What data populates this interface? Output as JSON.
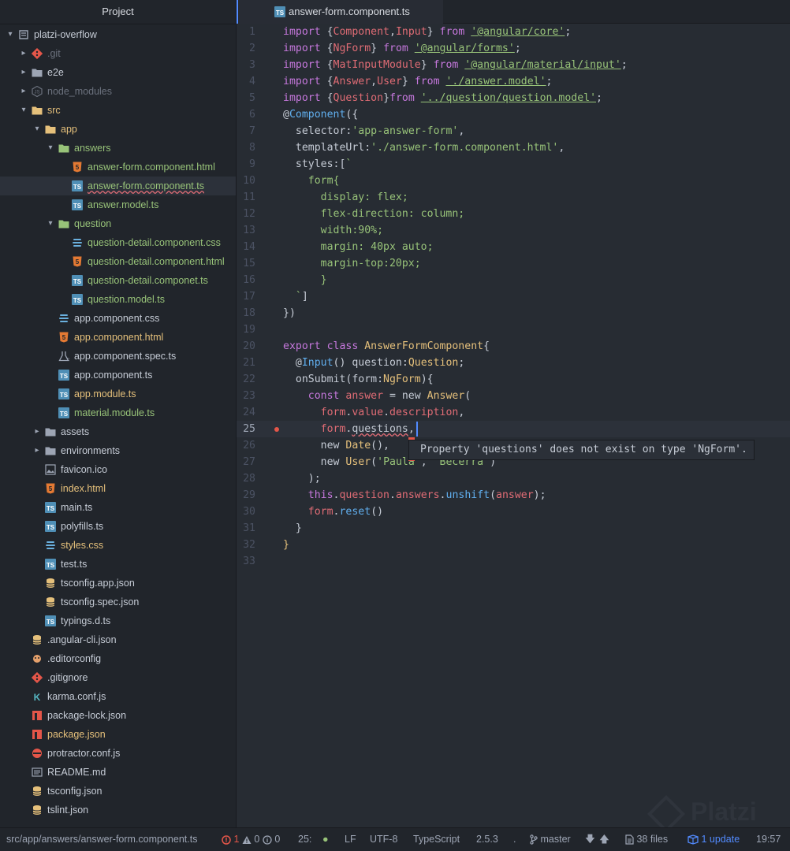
{
  "sidebar": {
    "title": "Project",
    "tree": [
      {
        "label": "platzi-overflow",
        "depth": 0,
        "type": "folder",
        "expanded": true,
        "color": "#c6ccd6",
        "icon": "repo-icon"
      },
      {
        "label": ".git",
        "depth": 1,
        "type": "folder",
        "expanded": false,
        "color": "#6b717d",
        "icon": "git-icon"
      },
      {
        "label": "e2e",
        "depth": 1,
        "type": "folder",
        "expanded": false,
        "color": "#c6ccd6",
        "icon": "folder-icon"
      },
      {
        "label": "node_modules",
        "depth": 1,
        "type": "folder",
        "expanded": false,
        "color": "#6b717d",
        "icon": "nodejs-icon"
      },
      {
        "label": "src",
        "depth": 1,
        "type": "folder",
        "expanded": true,
        "color": "#e5c07b",
        "icon": "folder-icon"
      },
      {
        "label": "app",
        "depth": 2,
        "type": "folder",
        "expanded": true,
        "color": "#e5c07b",
        "icon": "folder-icon"
      },
      {
        "label": "answers",
        "depth": 3,
        "type": "folder",
        "expanded": true,
        "color": "#98c379",
        "icon": "folder-icon"
      },
      {
        "label": "answer-form.component.html",
        "depth": 4,
        "type": "file",
        "color": "#98c379",
        "icon": "html5-icon"
      },
      {
        "label": "answer-form.component.ts",
        "depth": 4,
        "type": "file",
        "color": "#98c379",
        "icon": "typescript-icon",
        "selected": true,
        "error": true
      },
      {
        "label": "answer.model.ts",
        "depth": 4,
        "type": "file",
        "color": "#98c379",
        "icon": "typescript-icon"
      },
      {
        "label": "question",
        "depth": 3,
        "type": "folder",
        "expanded": true,
        "color": "#98c379",
        "icon": "folder-icon"
      },
      {
        "label": "question-detail.component.css",
        "depth": 4,
        "type": "file",
        "color": "#98c379",
        "icon": "css3-icon"
      },
      {
        "label": "question-detail.component.html",
        "depth": 4,
        "type": "file",
        "color": "#98c379",
        "icon": "html5-icon"
      },
      {
        "label": "question-detail.componet.ts",
        "depth": 4,
        "type": "file",
        "color": "#98c379",
        "icon": "typescript-icon"
      },
      {
        "label": "question.model.ts",
        "depth": 4,
        "type": "file",
        "color": "#98c379",
        "icon": "typescript-icon"
      },
      {
        "label": "app.component.css",
        "depth": 3,
        "type": "file",
        "color": "#c6ccd6",
        "icon": "css3-icon"
      },
      {
        "label": "app.component.html",
        "depth": 3,
        "type": "file",
        "color": "#e5c07b",
        "icon": "html5-icon"
      },
      {
        "label": "app.component.spec.ts",
        "depth": 3,
        "type": "file",
        "color": "#c6ccd6",
        "icon": "test-icon"
      },
      {
        "label": "app.component.ts",
        "depth": 3,
        "type": "file",
        "color": "#c6ccd6",
        "icon": "typescript-icon"
      },
      {
        "label": "app.module.ts",
        "depth": 3,
        "type": "file",
        "color": "#e5c07b",
        "icon": "typescript-icon"
      },
      {
        "label": "material.module.ts",
        "depth": 3,
        "type": "file",
        "color": "#98c379",
        "icon": "typescript-icon"
      },
      {
        "label": "assets",
        "depth": 2,
        "type": "folder",
        "expanded": false,
        "color": "#c6ccd6",
        "icon": "folder-icon"
      },
      {
        "label": "environments",
        "depth": 2,
        "type": "folder",
        "expanded": false,
        "color": "#c6ccd6",
        "icon": "folder-icon"
      },
      {
        "label": "favicon.ico",
        "depth": 2,
        "type": "file",
        "color": "#c6ccd6",
        "icon": "image-icon"
      },
      {
        "label": "index.html",
        "depth": 2,
        "type": "file",
        "color": "#e5c07b",
        "icon": "html5-icon"
      },
      {
        "label": "main.ts",
        "depth": 2,
        "type": "file",
        "color": "#c6ccd6",
        "icon": "typescript-icon"
      },
      {
        "label": "polyfills.ts",
        "depth": 2,
        "type": "file",
        "color": "#c6ccd6",
        "icon": "typescript-icon"
      },
      {
        "label": "styles.css",
        "depth": 2,
        "type": "file",
        "color": "#e5c07b",
        "icon": "css3-icon"
      },
      {
        "label": "test.ts",
        "depth": 2,
        "type": "file",
        "color": "#c6ccd6",
        "icon": "typescript-icon"
      },
      {
        "label": "tsconfig.app.json",
        "depth": 2,
        "type": "file",
        "color": "#c6ccd6",
        "icon": "database-icon"
      },
      {
        "label": "tsconfig.spec.json",
        "depth": 2,
        "type": "file",
        "color": "#c6ccd6",
        "icon": "database-icon"
      },
      {
        "label": "typings.d.ts",
        "depth": 2,
        "type": "file",
        "color": "#c6ccd6",
        "icon": "typescript-icon"
      },
      {
        "label": ".angular-cli.json",
        "depth": 1,
        "type": "file",
        "color": "#c6ccd6",
        "icon": "database-icon"
      },
      {
        "label": ".editorconfig",
        "depth": 1,
        "type": "file",
        "color": "#c6ccd6",
        "icon": "editorconfig-icon"
      },
      {
        "label": ".gitignore",
        "depth": 1,
        "type": "file",
        "color": "#c6ccd6",
        "icon": "git-icon"
      },
      {
        "label": "karma.conf.js",
        "depth": 1,
        "type": "file",
        "color": "#c6ccd6",
        "icon": "karma-icon"
      },
      {
        "label": "package-lock.json",
        "depth": 1,
        "type": "file",
        "color": "#c6ccd6",
        "icon": "npm-icon"
      },
      {
        "label": "package.json",
        "depth": 1,
        "type": "file",
        "color": "#e5c07b",
        "icon": "npm-icon"
      },
      {
        "label": "protractor.conf.js",
        "depth": 1,
        "type": "file",
        "color": "#c6ccd6",
        "icon": "protractor-icon"
      },
      {
        "label": "README.md",
        "depth": 1,
        "type": "file",
        "color": "#c6ccd6",
        "icon": "markdown-icon"
      },
      {
        "label": "tsconfig.json",
        "depth": 1,
        "type": "file",
        "color": "#c6ccd6",
        "icon": "database-icon"
      },
      {
        "label": "tslint.json",
        "depth": 1,
        "type": "file",
        "color": "#c6ccd6",
        "icon": "database-icon"
      }
    ]
  },
  "tab": {
    "label": "answer-form.component.ts",
    "icon": "typescript-icon"
  },
  "editor": {
    "active_line": 25,
    "lines": [
      [
        [
          "kw",
          "import "
        ],
        [
          "pl",
          "{"
        ],
        [
          "id",
          "Component"
        ],
        [
          "pl",
          ","
        ],
        [
          "id",
          "Input"
        ],
        [
          "pl",
          "} "
        ],
        [
          "kw",
          "from "
        ],
        [
          "strl",
          "'@angular/core'"
        ],
        [
          "pl",
          ";"
        ]
      ],
      [
        [
          "kw",
          "import "
        ],
        [
          "pl",
          "{"
        ],
        [
          "id",
          "NgForm"
        ],
        [
          "pl",
          "} "
        ],
        [
          "kw",
          "from "
        ],
        [
          "strl",
          "'@angular/forms'"
        ],
        [
          "pl",
          ";"
        ]
      ],
      [
        [
          "kw",
          "import "
        ],
        [
          "pl",
          "{"
        ],
        [
          "id",
          "MatInputModule"
        ],
        [
          "pl",
          "} "
        ],
        [
          "kw",
          "from "
        ],
        [
          "strl",
          "'@angular/material/input'"
        ],
        [
          "pl",
          ";"
        ]
      ],
      [
        [
          "kw",
          "import "
        ],
        [
          "pl",
          "{"
        ],
        [
          "id",
          "Answer"
        ],
        [
          "pl",
          ","
        ],
        [
          "id",
          "User"
        ],
        [
          "pl",
          "} "
        ],
        [
          "kw",
          "from "
        ],
        [
          "strl",
          "'./answer.model'"
        ],
        [
          "pl",
          ";"
        ]
      ],
      [
        [
          "kw",
          "import "
        ],
        [
          "pl",
          "{"
        ],
        [
          "id",
          "Question"
        ],
        [
          "pl",
          "}"
        ],
        [
          "kw",
          "from "
        ],
        [
          "strl",
          "'../question/question.model'"
        ],
        [
          "pl",
          ";"
        ]
      ],
      [
        [
          "pl",
          "@"
        ],
        [
          "fn",
          "Component"
        ],
        [
          "pl",
          "({"
        ]
      ],
      [
        [
          "pl",
          "  selector"
        ],
        [
          "pl",
          ":"
        ],
        [
          "str",
          "'app-answer-form'"
        ],
        [
          "pl",
          ","
        ]
      ],
      [
        [
          "pl",
          "  templateUrl"
        ],
        [
          "pl",
          ":"
        ],
        [
          "str",
          "'./answer-form.component.html'"
        ],
        [
          "pl",
          ","
        ]
      ],
      [
        [
          "pl",
          "  styles"
        ],
        [
          "pl",
          ":["
        ],
        [
          "str",
          "`"
        ]
      ],
      [
        [
          "css",
          "    form{"
        ]
      ],
      [
        [
          "css",
          "      display: flex;"
        ]
      ],
      [
        [
          "css",
          "      flex-direction: column;"
        ]
      ],
      [
        [
          "css",
          "      width:90%;"
        ]
      ],
      [
        [
          "css",
          "      margin: 40px auto;"
        ]
      ],
      [
        [
          "css",
          "      margin-top:20px;"
        ]
      ],
      [
        [
          "css",
          "      }"
        ]
      ],
      [
        [
          "str",
          "  `"
        ],
        [
          "pl",
          "]"
        ]
      ],
      [
        [
          "pl",
          "})"
        ]
      ],
      [],
      [
        [
          "kw",
          "export class "
        ],
        [
          "cls",
          "AnswerFormComponent"
        ],
        [
          "pl",
          "{"
        ]
      ],
      [
        [
          "pl",
          "  @"
        ],
        [
          "fn",
          "Input"
        ],
        [
          "pl",
          "() "
        ],
        [
          "pl",
          "question:"
        ],
        [
          "cls",
          "Question"
        ],
        [
          "pl",
          ";"
        ]
      ],
      [
        [
          "pl",
          "  onSubmit(form:"
        ],
        [
          "cls",
          "NgForm"
        ],
        [
          "pl",
          "){"
        ]
      ],
      [
        [
          "kw",
          "    const "
        ],
        [
          "id",
          "answer"
        ],
        [
          "pl",
          " = new "
        ],
        [
          "cls",
          "Answer"
        ],
        [
          "pl",
          "("
        ]
      ],
      [
        [
          "id",
          "      form"
        ],
        [
          "pl",
          "."
        ],
        [
          "id",
          "value"
        ],
        [
          "pl",
          "."
        ],
        [
          "id",
          "description"
        ],
        [
          "pl",
          ","
        ]
      ],
      [
        [
          "id",
          "      form"
        ],
        [
          "pl",
          "."
        ],
        [
          "squig",
          "questions"
        ],
        [
          "pl",
          ","
        ]
      ],
      [
        [
          "pl",
          "      new "
        ],
        [
          "cls",
          "Date"
        ],
        [
          "pl",
          "(),"
        ]
      ],
      [
        [
          "pl",
          "      new "
        ],
        [
          "cls",
          "User"
        ],
        [
          "pl",
          "("
        ],
        [
          "str",
          "'Paula'"
        ],
        [
          "pl",
          ", "
        ],
        [
          "str",
          "'Becerra'"
        ],
        [
          "pl",
          ")"
        ]
      ],
      [
        [
          "pl",
          "    );"
        ]
      ],
      [
        [
          "kw",
          "    this"
        ],
        [
          "pl",
          "."
        ],
        [
          "id",
          "question"
        ],
        [
          "pl",
          "."
        ],
        [
          "id",
          "answers"
        ],
        [
          "pl",
          "."
        ],
        [
          "fn",
          "unshift"
        ],
        [
          "pl",
          "("
        ],
        [
          "id",
          "answer"
        ],
        [
          "pl",
          ");"
        ]
      ],
      [
        [
          "id",
          "    form"
        ],
        [
          "pl",
          "."
        ],
        [
          "fn",
          "reset"
        ],
        [
          "pl",
          "()"
        ]
      ],
      [
        [
          "pl",
          "  }"
        ]
      ],
      [
        [
          "cls",
          "}"
        ]
      ],
      []
    ]
  },
  "tooltip": {
    "text": "Property 'questions' does not exist on type 'NgForm'."
  },
  "watermark": {
    "text": "Platzi"
  },
  "status": {
    "path": "src/app/answers/answer-form.component.ts",
    "errors": "1",
    "warnings": "0",
    "infos": "0",
    "cursor": "25:",
    "line_ending": "LF",
    "encoding": "UTF-8",
    "grammar": "TypeScript",
    "ts_version": "2.5.3",
    "dot": ".",
    "branch": "master",
    "files": "38 files",
    "update": "1 update",
    "time": "19:57"
  }
}
